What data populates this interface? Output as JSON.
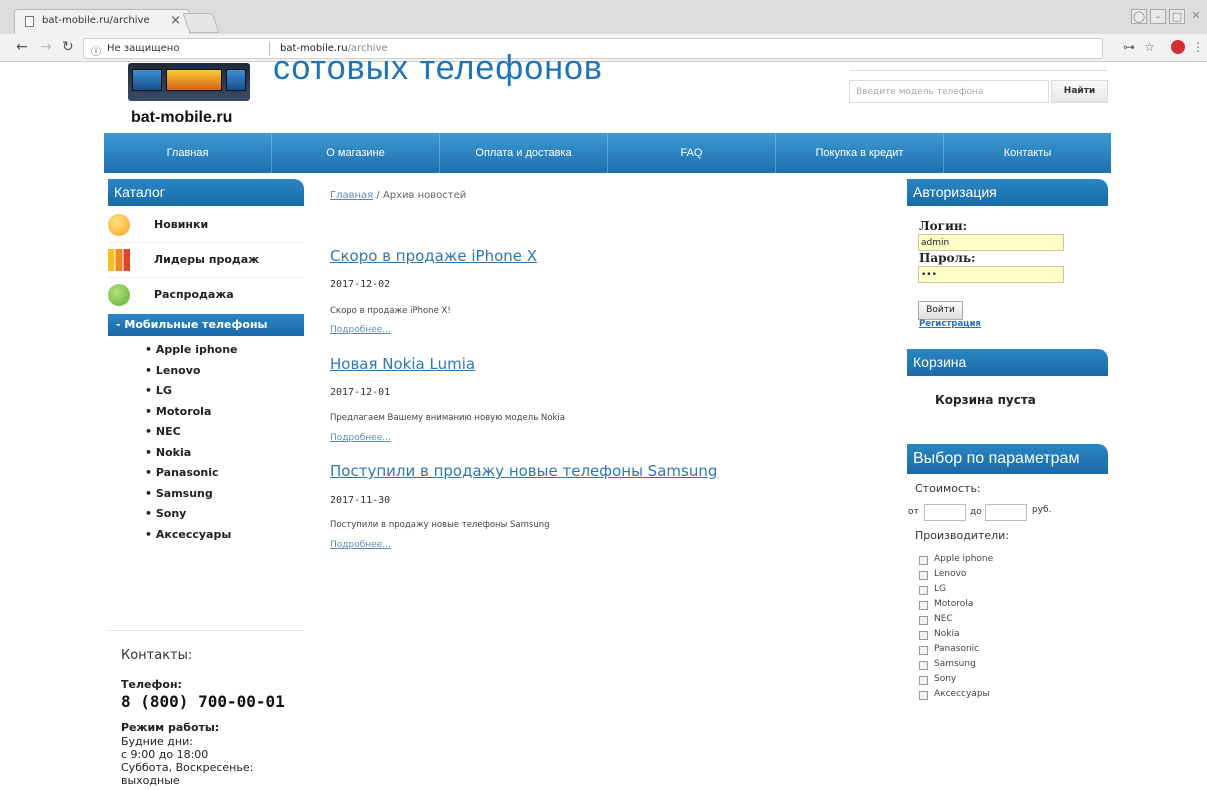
{
  "browser": {
    "tab_title": "bat-mobile.ru/archive",
    "tab_close": "×",
    "insecure_label": "Не защищено",
    "url_host": "bat-mobile.ru",
    "url_path": "/archive"
  },
  "header": {
    "logo_text": "bat-mobile.ru",
    "hero_title": "сотовых телефонов",
    "search_placeholder": "Введите модель телефона",
    "search_button": "Найти"
  },
  "menu": [
    {
      "label": "Главная"
    },
    {
      "label": "О магазине"
    },
    {
      "label": "Оплата и доставка"
    },
    {
      "label": "FAQ"
    },
    {
      "label": "Покупка в кредит"
    },
    {
      "label": "Контакты"
    }
  ],
  "catalog": {
    "title": "Каталог",
    "items": [
      {
        "label": "Новинки",
        "color": "#f2a623"
      },
      {
        "label": "Лидеры продаж",
        "color": "#e2452b"
      },
      {
        "label": "Распродажа",
        "color": "#5cb030"
      }
    ],
    "mobile_header": "- Мобильные телефоны",
    "brands": [
      "Apple iphone",
      "Lenovo",
      "LG",
      "Motorola",
      "NEC",
      "Nokia",
      "Panasonic",
      "Samsung",
      "Sony",
      "Аксессуары"
    ]
  },
  "contacts": {
    "title": "Контакты:",
    "phone_label": "Телефон:",
    "phone": "8 (800) 700-00-01",
    "hours_label": "Режим работы:",
    "hours_lines": [
      "Будние дни:",
      "с 9:00 до 18:00",
      "Суббота, Воскресенье:",
      "выходные"
    ]
  },
  "breadcrumb": {
    "home": "Главная",
    "separator": " / ",
    "current": "Архив новостей"
  },
  "news": [
    {
      "title": "Скоро в продаже iPhone X",
      "date": "2017-12-02",
      "text": "Скоро в продаже iPhone X!",
      "more": "Подробнее..."
    },
    {
      "title": "Новая Nokia Lumia",
      "date": "2017-12-01",
      "text": "Предлагаем Вашему вниманию новую модель Nokia",
      "more": "Подробнее..."
    },
    {
      "title": "Поступили в продажу новые телефоны Samsung",
      "date": "2017-11-30",
      "text": "Поступили в продажу новые телефоны Samsung",
      "more": "Подробнее..."
    }
  ],
  "auth": {
    "title": "Авторизация",
    "login_label": "Логин:",
    "login_value": "admin",
    "password_label": "Пароль:",
    "password_value": "•••",
    "button": "Войти",
    "register": "Регистрация"
  },
  "cart": {
    "title": "Корзина",
    "empty_text": "Корзина пуста"
  },
  "filter": {
    "title": "Выбор по параметрам",
    "price_label": "Стоимость:",
    "from_label": "от",
    "to_label": "до",
    "currency": "руб.",
    "makers_label": "Производители:",
    "makers": [
      "Apple iphone",
      "Lenovo",
      "LG",
      "Motorola",
      "NEC",
      "Nokia",
      "Panasonic",
      "Samsung",
      "Sony",
      "Аксессуары"
    ]
  }
}
